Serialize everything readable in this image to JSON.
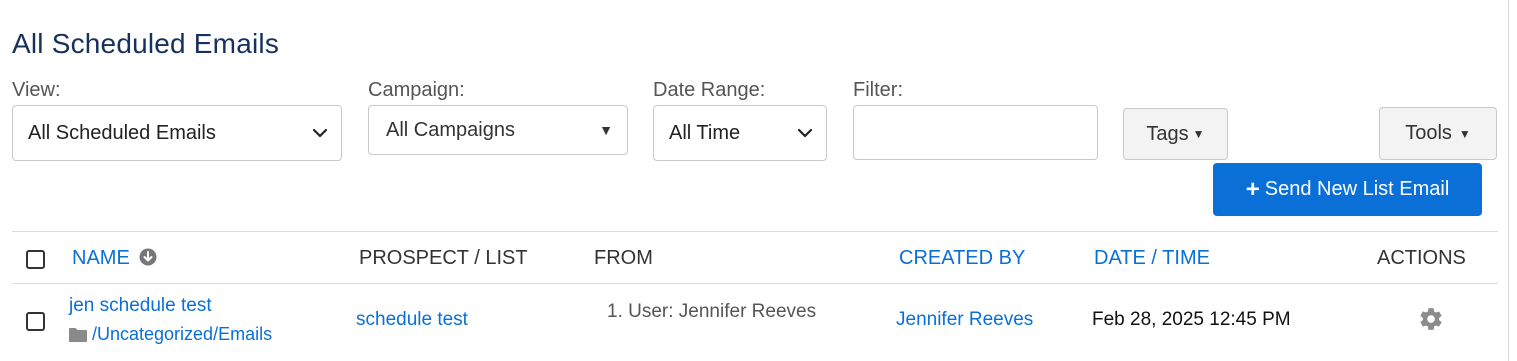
{
  "page": {
    "title": "All Scheduled Emails"
  },
  "filters": {
    "view_label": "View:",
    "view_value": "All Scheduled Emails",
    "campaign_label": "Campaign:",
    "campaign_value": "All Campaigns",
    "date_range_label": "Date Range:",
    "date_range_value": "All Time",
    "filter_label": "Filter:",
    "filter_value": ""
  },
  "toolbar": {
    "tags_label": "Tags",
    "tools_label": "Tools",
    "send_label": "Send New List Email"
  },
  "table": {
    "headers": {
      "name": "NAME",
      "prospect_list": "PROSPECT / LIST",
      "from": "FROM",
      "created_by": "CREATED BY",
      "date_time": "DATE / TIME",
      "actions": "ACTIONS"
    },
    "rows": [
      {
        "name": "jen schedule test",
        "folder": "/Uncategorized/Emails",
        "prospect_list": "schedule test",
        "from": "1. User: Jennifer Reeves",
        "created_by": "Jennifer Reeves",
        "date_time": "Feb 28, 2025 12:45 PM",
        "action_icon": "gear-icon"
      }
    ]
  },
  "colors": {
    "title": "#16325c",
    "link": "#0a6fd6",
    "primary_button": "#0a6fd6"
  }
}
